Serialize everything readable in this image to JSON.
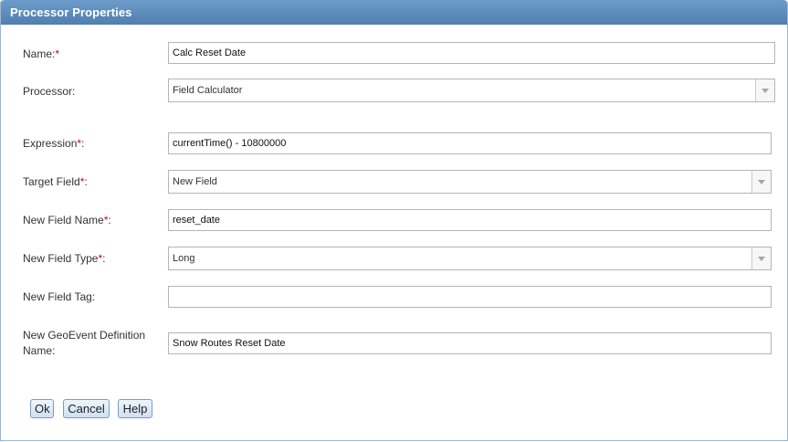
{
  "dialog": {
    "title": "Processor Properties"
  },
  "form": {
    "required_marker": "*",
    "name": {
      "label": "Name:",
      "value": "Calc Reset Date"
    },
    "processor": {
      "label": "Processor:",
      "value": "Field Calculator"
    },
    "expression": {
      "label": "Expression",
      "suffix": ":",
      "value": "currentTime() - 10800000"
    },
    "target_field": {
      "label": "Target Field",
      "suffix": ":",
      "value": "New Field"
    },
    "new_field_name": {
      "label": "New Field Name",
      "suffix": ":",
      "value": "reset_date"
    },
    "new_field_type": {
      "label": "New Field Type",
      "suffix": ":",
      "value": "Long"
    },
    "new_field_tag": {
      "label": "New Field Tag:",
      "value": ""
    },
    "geoevent_definition_name": {
      "label_line1": "New GeoEvent Definition",
      "label_line2": "Name:",
      "value": "Snow Routes Reset Date"
    }
  },
  "buttons": {
    "ok": "Ok",
    "cancel": "Cancel",
    "help": "Help"
  },
  "colors": {
    "titlebar": "#5a89bb",
    "required": "#d00000",
    "button_border": "#7d9cc0"
  }
}
